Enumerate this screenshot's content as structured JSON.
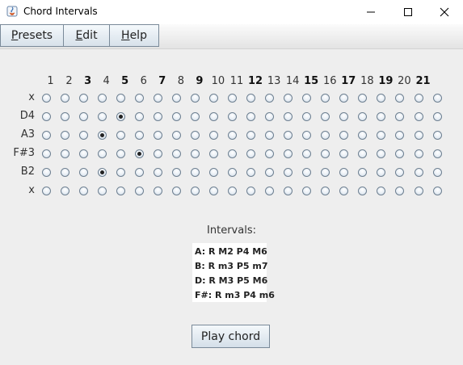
{
  "window": {
    "title": "Chord Intervals"
  },
  "menu": [
    {
      "label": "Presets",
      "mnemonic": "P",
      "rest": "resets"
    },
    {
      "label": "Edit",
      "mnemonic": "E",
      "rest": "dit"
    },
    {
      "label": "Help",
      "mnemonic": "H",
      "rest": "elp"
    }
  ],
  "frets": [
    {
      "n": "1",
      "bold": false
    },
    {
      "n": "2",
      "bold": false
    },
    {
      "n": "3",
      "bold": true
    },
    {
      "n": "4",
      "bold": false
    },
    {
      "n": "5",
      "bold": true
    },
    {
      "n": "6",
      "bold": false
    },
    {
      "n": "7",
      "bold": true
    },
    {
      "n": "8",
      "bold": false
    },
    {
      "n": "9",
      "bold": true
    },
    {
      "n": "10",
      "bold": false
    },
    {
      "n": "11",
      "bold": false
    },
    {
      "n": "12",
      "bold": true
    },
    {
      "n": "13",
      "bold": false
    },
    {
      "n": "14",
      "bold": false
    },
    {
      "n": "15",
      "bold": true
    },
    {
      "n": "16",
      "bold": false
    },
    {
      "n": "17",
      "bold": true
    },
    {
      "n": "18",
      "bold": false
    },
    {
      "n": "19",
      "bold": true
    },
    {
      "n": "20",
      "bold": false
    },
    {
      "n": "21",
      "bold": true
    }
  ],
  "strings": [
    {
      "label": "x",
      "selected": null
    },
    {
      "label": "D4",
      "selected": 4
    },
    {
      "label": "A3",
      "selected": 3
    },
    {
      "label": "F#3",
      "selected": 5
    },
    {
      "label": "B2",
      "selected": 3
    },
    {
      "label": "x",
      "selected": null
    }
  ],
  "intervals": {
    "title": "Intervals:",
    "lines": [
      "A: R M2 P4 M6",
      "B: R m3 P5 m7",
      "D: R M3 P5 M6",
      "F#: R m3 P4 m6"
    ]
  },
  "play_button": "Play chord"
}
